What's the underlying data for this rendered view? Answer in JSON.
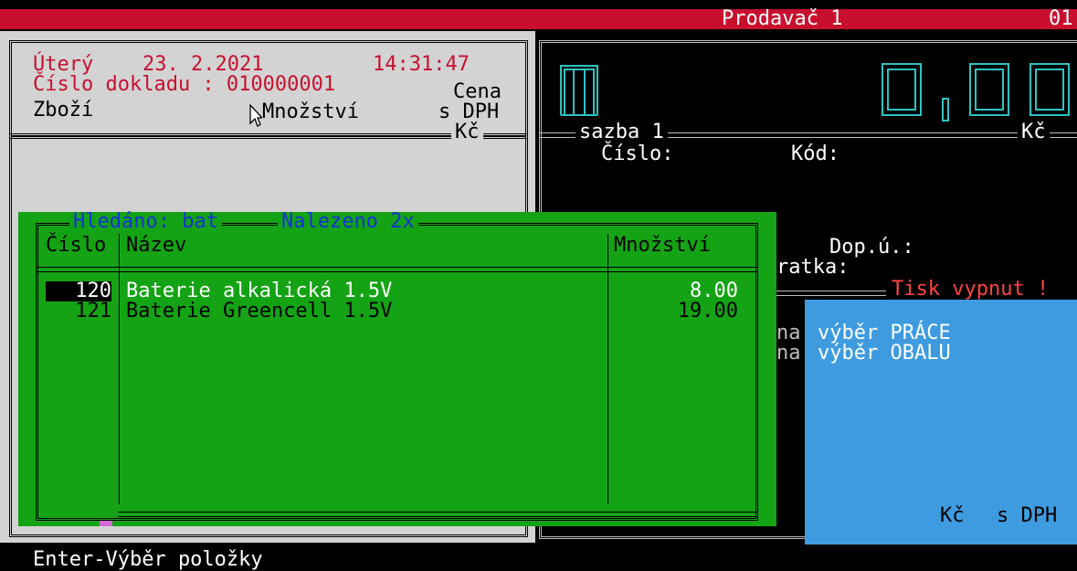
{
  "colors": {
    "top_bar": "#c8102e",
    "receipt_bg": "#d3d3d3",
    "dark_bg": "#000000",
    "dialog_bg": "#14a314",
    "side_panel": "#3e9be0",
    "red_text": "#c8102e",
    "blue_text": "#1533d6",
    "cyan_digits": "#2fc2c2"
  },
  "topbar": {
    "seller": "Prodavač 1",
    "code": "01"
  },
  "receipt": {
    "weekday": "Úterý",
    "date": "23. 2.2021",
    "time": "14:31:47",
    "doc_label": "Číslo dokladu : 010000001",
    "price_label": "Cena",
    "goods_label": "Zboží",
    "qty_label": "Množství",
    "vat_label": "s DPH",
    "currency": "Kč"
  },
  "display": {
    "symbol": "M",
    "amount": "0,00",
    "rate_label": "sazba 1",
    "currency": "Kč",
    "number_label": "Číslo:",
    "code_label": "Kód:",
    "dop_label": "Dop.ú.:",
    "ratka_label": "ratka:",
    "print_status": "Tisk vypnut !"
  },
  "dialog": {
    "search_label": "Hledáno: bat",
    "found_label": "Nalezeno 2x",
    "columns": [
      "Číslo",
      "Název",
      "Množství"
    ],
    "rows": [
      {
        "number": "120",
        "name": "Baterie alkalická 1.5V",
        "qty": "8.00"
      },
      {
        "number": "121",
        "name": "Baterie Greencell 1.5V",
        "qty": "19.00"
      }
    ]
  },
  "side_panel": {
    "item1_prefix": "na",
    "item1": "výběr PRÁCE",
    "item2_prefix": "na",
    "item2": "výběr OBALU",
    "footer_currency": "Kč",
    "footer_vat": "s DPH"
  },
  "status_bar": {
    "hint": "Enter-Výběr položky"
  }
}
